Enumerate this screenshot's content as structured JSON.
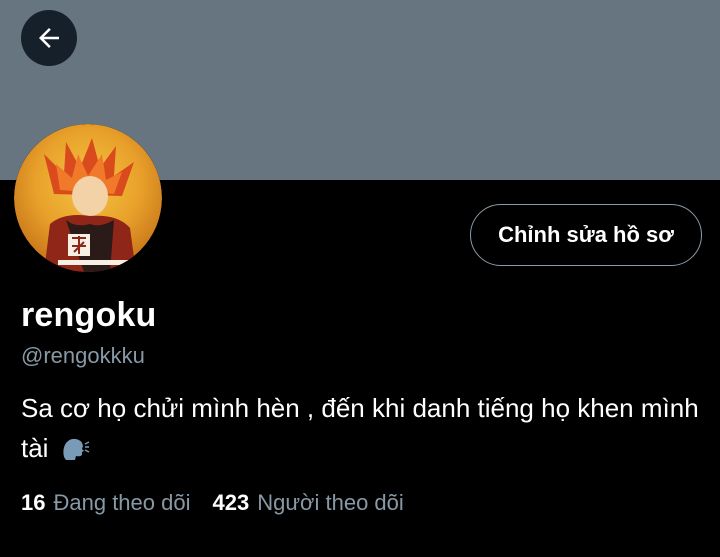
{
  "colors": {
    "banner": "#66757f",
    "background": "#000000",
    "secondary_text": "#8899a6",
    "back_button_bg": "#15202b"
  },
  "header": {
    "back_icon": "arrow-left-icon"
  },
  "profile": {
    "avatar_icon": "avatar-image",
    "edit_button_label": "Chỉnh sửa hồ sơ",
    "display_name": "rengoku",
    "handle": "@rengokkku",
    "bio": "Sa cơ họ chửi mình hèn , đến khi danh tiếng họ khen mình tài",
    "bio_emoji_icon": "speaking-head-icon"
  },
  "stats": {
    "following_count": "16",
    "following_label": "Đang theo dõi",
    "followers_count": "423",
    "followers_label": "Người theo dõi"
  }
}
